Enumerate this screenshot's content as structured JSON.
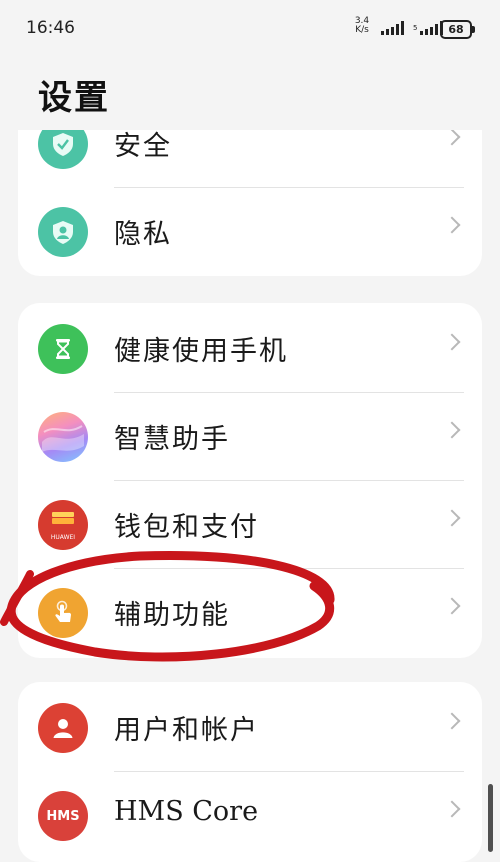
{
  "status_bar": {
    "time": "16:46",
    "net_speed_value": "3.4",
    "net_speed_unit": "K/s",
    "signal2_label": "5",
    "battery": "68"
  },
  "header": {
    "title": "设置"
  },
  "groups": [
    {
      "items": [
        {
          "label": "安全",
          "icon": "shield-check-icon",
          "color": "#4cc3a5"
        },
        {
          "label": "隐私",
          "icon": "privacy-shield-icon",
          "color": "#4cc3a5"
        }
      ]
    },
    {
      "items": [
        {
          "label": "健康使用手机",
          "icon": "hourglass-icon",
          "color": "#3ec15a"
        },
        {
          "label": "智慧助手",
          "icon": "assistant-orb-icon",
          "color": "#c38af0"
        },
        {
          "label": "钱包和支付",
          "icon": "wallet-icon",
          "color": "#d63b2f",
          "badge": "HUAWEI"
        },
        {
          "label": "辅助功能",
          "icon": "hand-tap-icon",
          "color": "#f0a431"
        }
      ]
    },
    {
      "items": [
        {
          "label": "用户和帐户",
          "icon": "user-icon",
          "color": "#dc4134"
        },
        {
          "label": "HMS Core",
          "icon": "hms-icon",
          "color": "#d9413a",
          "badge": "HMS"
        }
      ]
    }
  ],
  "colors": {
    "background": "#f4f4f4",
    "card": "#ffffff",
    "annotation_stroke": "#c8161b"
  }
}
